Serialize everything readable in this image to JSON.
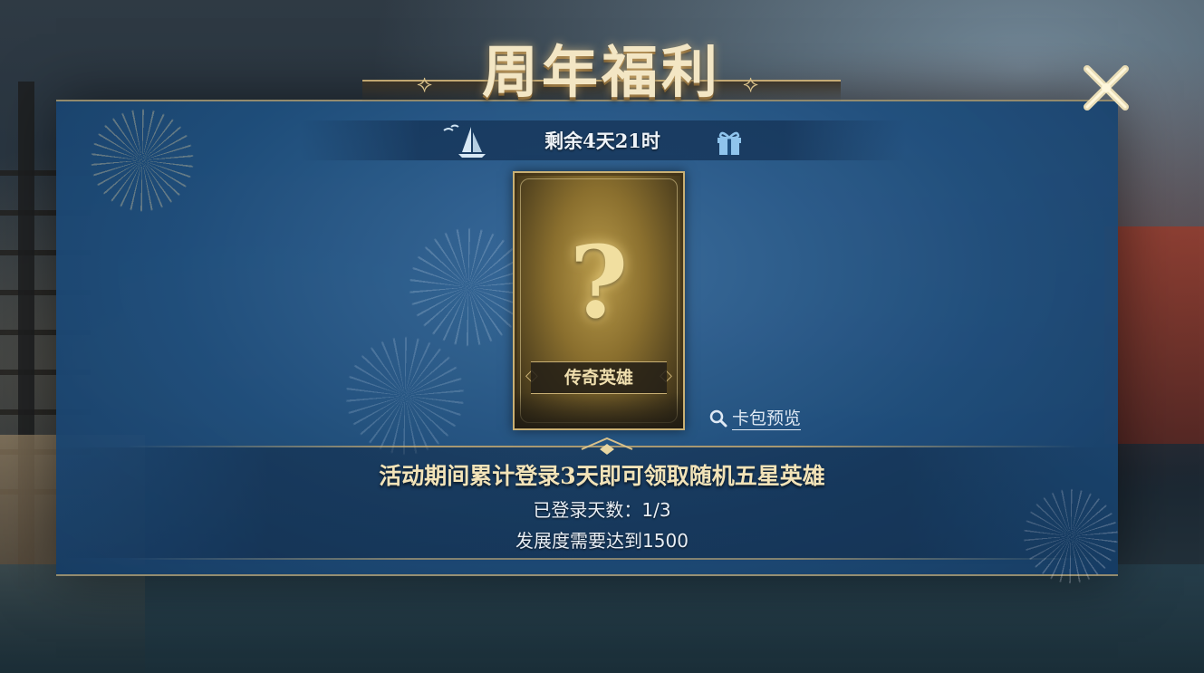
{
  "header": {
    "title": "周年福利",
    "close_icon": "close-icon"
  },
  "timer": {
    "remaining": "剩余4天21时",
    "left_icon": "sailboat-icon",
    "right_icon": "gift-icon"
  },
  "card": {
    "symbol": "?",
    "label": "传奇英雄"
  },
  "preview": {
    "label": "卡包预览",
    "icon": "search-icon"
  },
  "requirements": {
    "description": "活动期间累计登录3天即可领取随机五星英雄",
    "login_progress": "已登录天数：1/3",
    "development_requirement": "发展度需要达到1500"
  },
  "colors": {
    "gold": "#f2e3b8",
    "panel_blue": "#1e4e7d",
    "text_light": "#e8eef5"
  }
}
